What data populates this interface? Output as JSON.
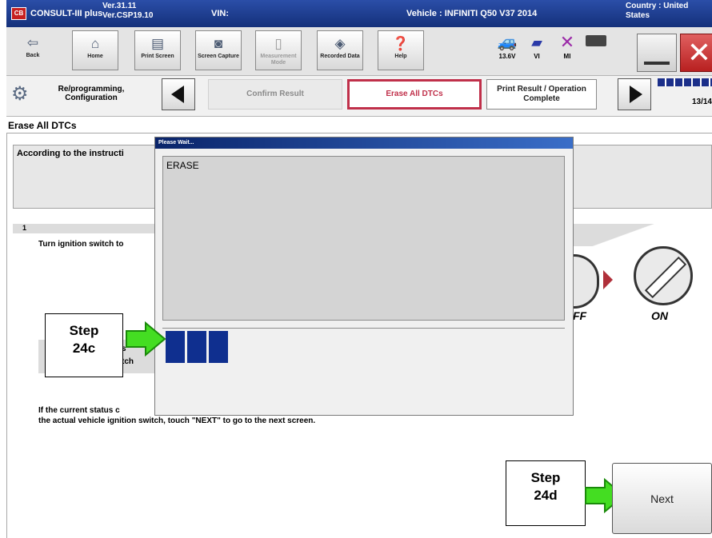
{
  "title_bar": {
    "app_name": "CONSULT-III plus",
    "version_line1": "Ver.31.11",
    "version_line2": "Ver.CSP19.10",
    "vin_label": "VIN:",
    "vehicle": "Vehicle : INFINITI Q50 V37 2014",
    "country_line1": "Country : United",
    "country_line2": "States"
  },
  "toolbar": {
    "back": "Back",
    "home": "Home",
    "print_screen": "Print Screen",
    "screen_capture": "Screen Capture",
    "measurement_mode": "Measurement Mode",
    "recorded_data": "Recorded Data",
    "help": "Help",
    "voltage": "13.6V",
    "vi": "VI",
    "mi": "MI"
  },
  "navbar": {
    "section": "Re/programming, Configuration",
    "steps": [
      "Confirm Result",
      "Erase All DTCs",
      "Print Result / Operation Complete"
    ],
    "page_counter": "13/14"
  },
  "screen_title": "Erase All DTCs",
  "instruction_text": "According to the instructi",
  "step1": {
    "number": "1",
    "text": "Turn ignition switch to",
    "status_label_partial": "tch",
    "status_label_partial2": "s",
    "footer_line1": "If the current status c",
    "footer_line2": "the actual vehicle ignition switch, touch \"NEXT\" to go to the next screen.",
    "off_label": "FF",
    "on_label": "ON"
  },
  "popup": {
    "title": "Please Wait...",
    "message": "ERASE",
    "progress_blocks": 3
  },
  "callouts": {
    "step_c_line1": "Step",
    "step_c_line2": "24c",
    "step_d_line1": "Step",
    "step_d_line2": "24d"
  },
  "next_button": "Next",
  "colors": {
    "titlebar": "#1f3f95",
    "active_step_border": "#c0304a",
    "progress_block": "#0f2f8f",
    "callout_arrow": "#44dd22"
  }
}
